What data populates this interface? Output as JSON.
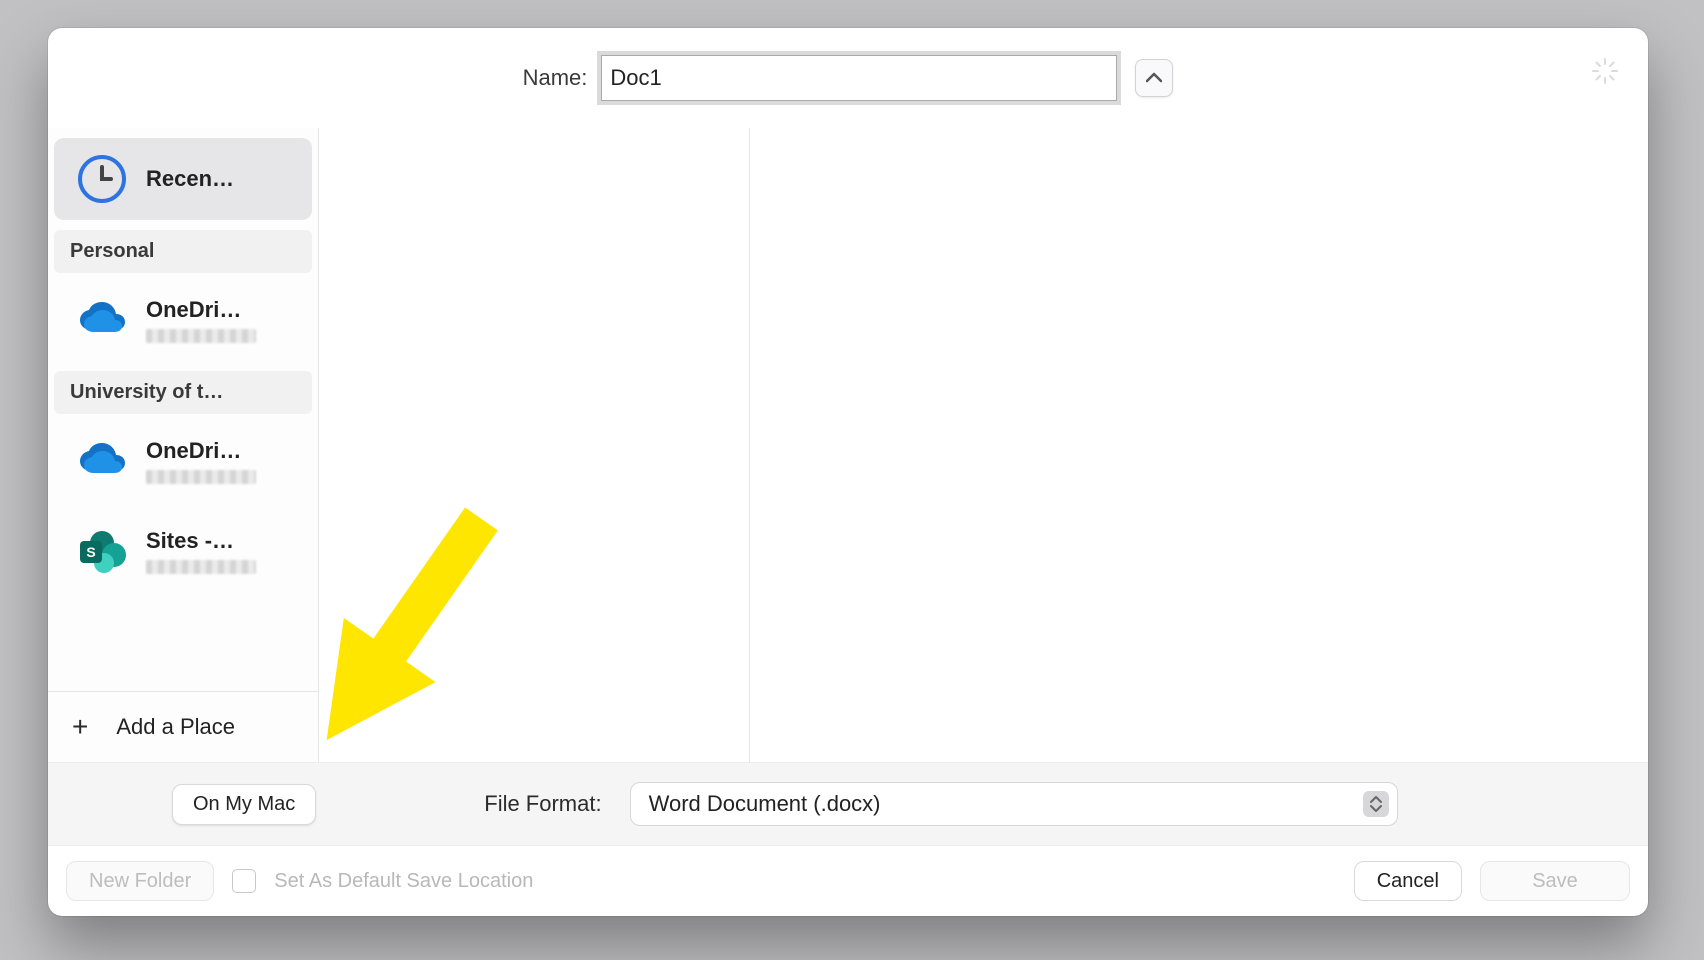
{
  "name_row": {
    "label": "Name:",
    "value": "Doc1"
  },
  "sidebar": {
    "recent_label": "Recen…",
    "groups": [
      {
        "header": "Personal",
        "items": [
          {
            "icon": "onedrive",
            "title": "OneDri…"
          }
        ]
      },
      {
        "header": "University of t…",
        "items": [
          {
            "icon": "onedrive",
            "title": "OneDri…"
          },
          {
            "icon": "sharepoint",
            "title": "Sites -…"
          }
        ]
      }
    ],
    "add_place": "Add a Place"
  },
  "format_bar": {
    "on_my_mac": "On My Mac",
    "file_format_label": "File Format:",
    "file_format_value": "Word Document (.docx)"
  },
  "action_bar": {
    "new_folder": "New Folder",
    "default_save_label": "Set As Default Save Location",
    "cancel": "Cancel",
    "save": "Save"
  }
}
